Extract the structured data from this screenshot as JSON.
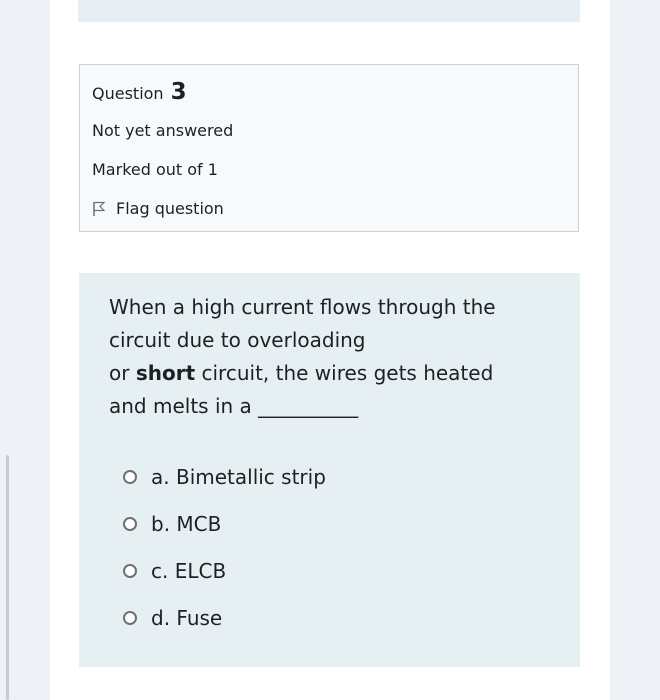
{
  "question": {
    "label": "Question",
    "number": "3",
    "state": "Not yet answered",
    "grade": "Marked out of 1",
    "flag_label": "Flag question"
  },
  "text": {
    "line1": "When a high current flows through the",
    "line2": "circuit due to overloading",
    "line3_prefix": "or ",
    "line3_bold": "short",
    "line3_suffix": " circuit, the wires gets heated",
    "line4": "and melts in a ",
    "blank": "__________"
  },
  "answers": [
    {
      "label": "a. Bimetallic strip"
    },
    {
      "label": "b. MCB"
    },
    {
      "label": "c. ELCB"
    },
    {
      "label": "d. Fuse"
    }
  ],
  "icons": {
    "flag": "flag-icon",
    "radio": "radio-icon"
  },
  "colors": {
    "info_bg": "#f8f9fa",
    "content_bg": "#e6f0f3",
    "text": "#1d2125"
  }
}
